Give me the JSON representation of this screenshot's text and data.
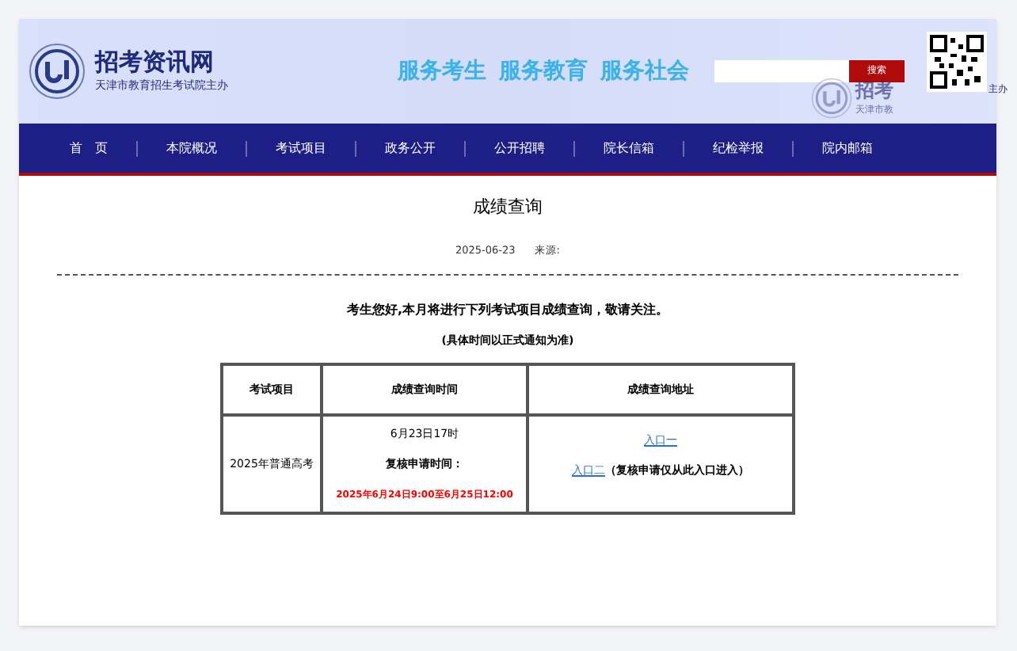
{
  "header": {
    "site_name": "招考资讯网",
    "sponsor": "天津市教育招生考试院主办",
    "slogan": [
      "服务考生",
      "服务教育",
      "服务社会"
    ],
    "search_button": "搜索",
    "background_logo": {
      "title": "招考",
      "sponsor": "天津市教",
      "sponsor_tail": "主办"
    }
  },
  "nav": [
    "首　页",
    "本院概况",
    "考试项目",
    "政务公开",
    "公开招聘",
    "院长信箱",
    "纪检举报",
    "院内邮箱"
  ],
  "article": {
    "title": "成绩查询",
    "date": "2025-06-23",
    "source_label": "来源:",
    "intro": "考生您好,本月将进行下列考试项目成绩查询，敬请关注。",
    "note": "(具体时间以正式通知为准)"
  },
  "table": {
    "columns": [
      "考试项目",
      "成绩查询时间",
      "成绩查询地址"
    ],
    "rows": [
      {
        "exam": "2025年普通高考",
        "time": "6月23日17时",
        "review_label": "复核申请时间：",
        "review_period": "2025年6月24日9:00至6月25日12:00",
        "link_1": "入口一",
        "link_2": "入口二",
        "link_2_note": "（复核申请仅从此入口进入）"
      }
    ]
  }
}
